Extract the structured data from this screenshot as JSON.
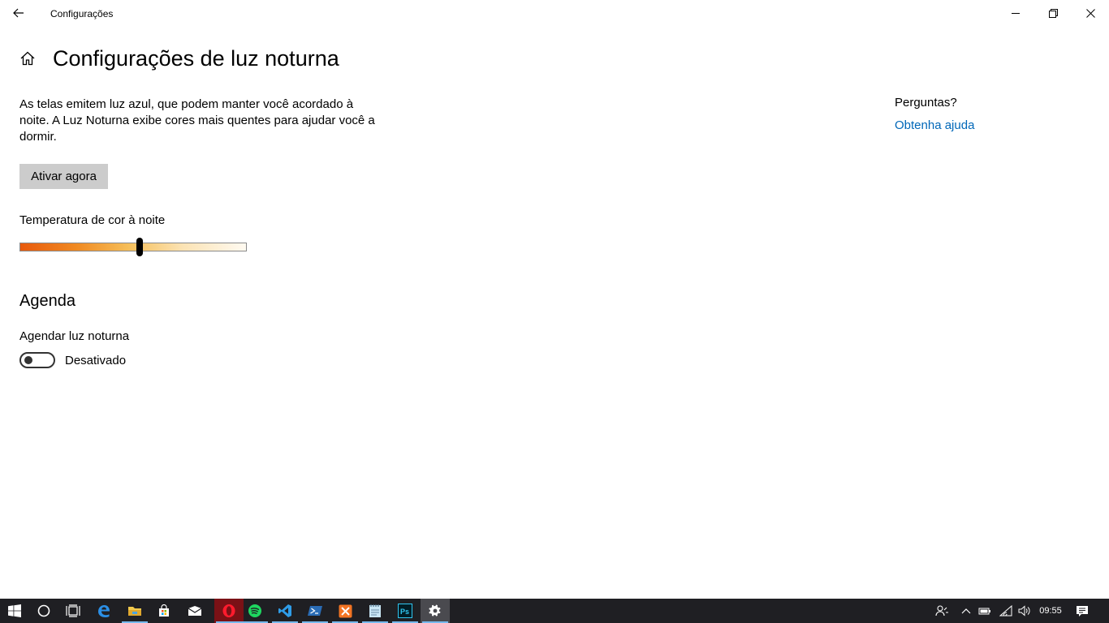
{
  "window": {
    "title": "Configurações"
  },
  "page": {
    "title": "Configurações de luz noturna",
    "description": "As telas emitem luz azul, que podem manter você acordado à noite. A Luz Noturna exibe cores mais quentes para ajudar você a dormir.",
    "activate_button": "Ativar agora",
    "temperature": {
      "label": "Temperatura de cor à noite",
      "value_fraction": 0.53
    }
  },
  "schedule": {
    "title": "Agenda",
    "toggle_label": "Agendar luz noturna",
    "toggle_state": "Desativado",
    "toggle_on": false
  },
  "sidebar": {
    "question": "Perguntas?",
    "help_link": "Obtenha ajuda"
  },
  "taskbar": {
    "apps": [
      {
        "name": "start",
        "icon": "windows-logo-icon"
      },
      {
        "name": "cortana",
        "icon": "cortana-circle-icon"
      },
      {
        "name": "task-view",
        "icon": "task-view-icon"
      },
      {
        "name": "edge",
        "icon": "edge-icon"
      },
      {
        "name": "file-explorer",
        "icon": "folder-icon"
      },
      {
        "name": "store",
        "icon": "store-bag-icon"
      },
      {
        "name": "mail",
        "icon": "mail-icon"
      },
      {
        "name": "opera",
        "icon": "opera-icon"
      },
      {
        "name": "spotify",
        "icon": "spotify-icon"
      },
      {
        "name": "vscode",
        "icon": "vscode-icon"
      },
      {
        "name": "powershell",
        "icon": "powershell-icon"
      },
      {
        "name": "xampp",
        "icon": "xampp-icon"
      },
      {
        "name": "notepad",
        "icon": "notepad-icon"
      },
      {
        "name": "photoshop",
        "icon": "photoshop-icon",
        "label": "Ps"
      },
      {
        "name": "settings",
        "icon": "gear-icon"
      }
    ],
    "clock": "09:55"
  },
  "colors": {
    "accent_link": "#0067b8",
    "button_bg": "#cccccc",
    "taskbar_bg": "#1f1f23",
    "running_indicator": "#76b9ed"
  }
}
